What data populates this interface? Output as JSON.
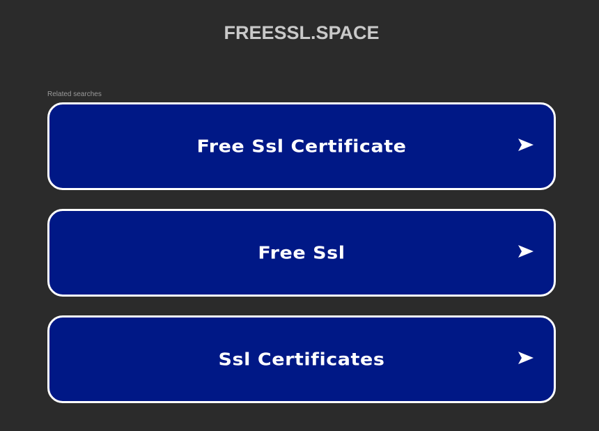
{
  "header": {
    "site_title": "FREESSL.SPACE"
  },
  "related": {
    "label": "Related searches",
    "items": [
      {
        "label": "Free Ssl Certificate",
        "icon": "arrow-right-icon"
      },
      {
        "label": "Free Ssl",
        "icon": "arrow-right-icon"
      },
      {
        "label": "Ssl Certificates",
        "icon": "arrow-right-icon"
      }
    ]
  },
  "colors": {
    "background": "#2b2b2b",
    "card_fill": "#001886",
    "card_border": "#ffffff",
    "title_text": "#c9c9c9",
    "label_text": "#9a9a9a"
  }
}
